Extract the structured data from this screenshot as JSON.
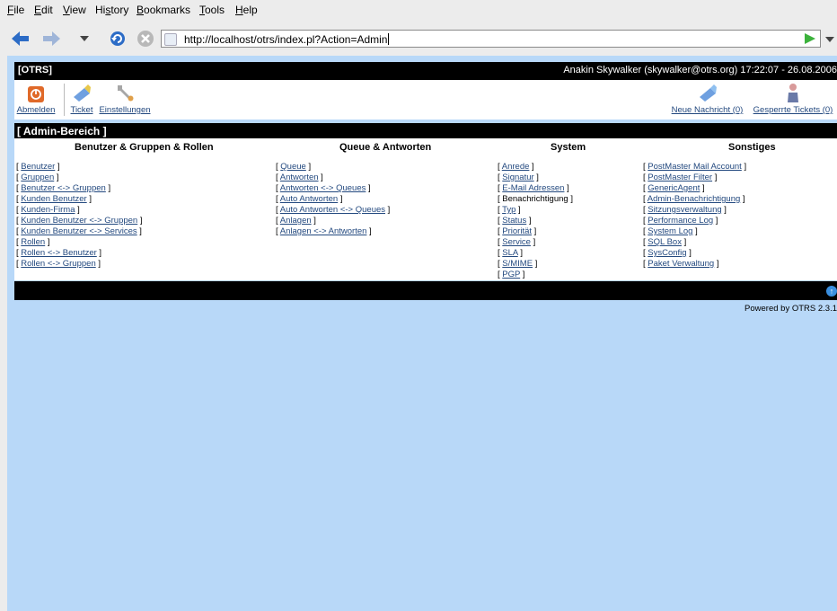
{
  "menu": [
    "File",
    "Edit",
    "View",
    "History",
    "Bookmarks",
    "Tools",
    "Help"
  ],
  "url": "http://localhost/otrs/index.pl?Action=Admin",
  "otrs": {
    "brand": "[OTRS]",
    "user_info": "Anakin Skywalker (skywalker@otrs.org) 17:22:07 - 26.08.2006",
    "toolbar_left": [
      "Abmelden",
      "Ticket",
      "Einstellungen"
    ],
    "toolbar_right": [
      "Neue Nachricht (0)",
      "Gesperrte Tickets (0)"
    ],
    "admin_title": "[ Admin-Bereich ]",
    "columns": [
      {
        "title": "Benutzer & Gruppen & Rollen",
        "items": [
          "Benutzer",
          "Gruppen",
          "Benutzer <-> Gruppen",
          "Kunden Benutzer",
          "Kunden-Firma",
          "Kunden Benutzer <-> Gruppen",
          "Kunden Benutzer <-> Services",
          "Rollen",
          "Rollen <-> Benutzer",
          "Rollen <-> Gruppen"
        ]
      },
      {
        "title": "Queue & Antworten",
        "items": [
          "Queue",
          "Antworten",
          "Antworten <-> Queues",
          "Auto Antworten",
          "Auto Antworten <-> Queues",
          "Anlagen",
          "Anlagen <-> Antworten"
        ]
      },
      {
        "title": "System",
        "items": [
          "Anrede",
          "Signatur",
          "E-Mail Adressen",
          "Benachrichtigung",
          "Typ",
          "Status",
          "Priorität",
          "Service",
          "SLA",
          "S/MIME",
          "PGP"
        ]
      },
      {
        "title": "Sonstiges",
        "items": [
          "PostMaster Mail Account",
          "PostMaster Filter",
          "GenericAgent",
          "Admin-Benachrichtigung",
          "Sitzungsverwaltung",
          "Performance Log",
          "System Log",
          "SQL Box",
          "SysConfig",
          "Paket Verwaltung"
        ]
      }
    ],
    "powered_by": "Powered by OTRS 2.3.1",
    "colors": {
      "header_bg": "#000000",
      "link": "#23497f",
      "page_bg": "#b8d8f8"
    }
  }
}
